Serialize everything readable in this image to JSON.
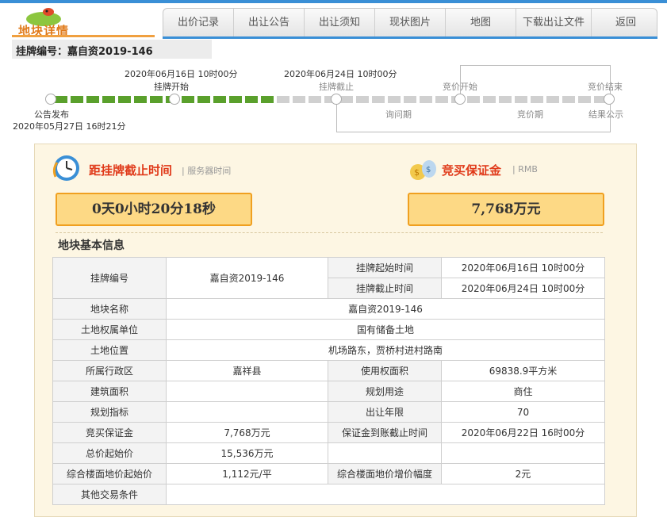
{
  "brand": {
    "title": "地块详情"
  },
  "nav": {
    "items": [
      "出价记录",
      "出让公告",
      "出让须知",
      "现状图片",
      "地图",
      "下载出让文件",
      "返回"
    ]
  },
  "page": {
    "listing_title": "挂牌编号：嘉自资2019-146"
  },
  "timeline": {
    "start_date": "2020年06月16日 10时00分",
    "start_label": "挂牌开始",
    "end_date": "2020年06月24日 10时00分",
    "end_label": "挂牌截止",
    "bid_start": "竞价开始",
    "bid_end": "竞价结束",
    "inquiry": "询问期",
    "bidding": "竞价期",
    "result": "结果公示",
    "publish_label": "公告发布",
    "publish_date": "2020年05月27日 16时21分",
    "colors": {
      "done": "#5aa02c",
      "pending": "#d0d0d0"
    }
  },
  "countdown": {
    "title": "距挂牌截止时间",
    "sub": "| 服务器时间",
    "value": "0天0小时20分18秒"
  },
  "deposit": {
    "title": "竞买保证金",
    "sub": "| RMB",
    "value": "7,768万元"
  },
  "basic_info": {
    "heading": "地块基本信息",
    "labels": {
      "listing_no": "挂牌编号",
      "start_time": "挂牌起始时间",
      "end_time": "挂牌截止时间",
      "parcel_name": "地块名称",
      "ownership": "土地权属单位",
      "location": "土地位置",
      "district": "所属行政区",
      "use_area": "使用权面积",
      "building_area": "建筑面积",
      "planned_use": "规划用途",
      "plan_index": "规划指标",
      "term": "出让年限",
      "deposit": "竞买保证金",
      "deposit_deadline": "保证金到账截止时间",
      "start_price": "总价起始价",
      "floor_price": "综合楼面地价起始价",
      "increment": "综合楼面地价增价幅度",
      "other": "其他交易条件"
    },
    "values": {
      "listing_no": "嘉自资2019-146",
      "start_time": "2020年06月16日 10时00分",
      "end_time": "2020年06月24日 10时00分",
      "parcel_name": "嘉自资2019-146",
      "ownership": "国有储备土地",
      "location": "机场路东，贾桥村进村路南",
      "district": "嘉祥县",
      "use_area": "69838.9平方米",
      "building_area": "",
      "planned_use": "商住",
      "plan_index": "",
      "term": "70",
      "deposit": "7,768万元",
      "deposit_deadline": "2020年06月22日 16时00分",
      "start_price": "15,536万元",
      "floor_price": "1,112元/平",
      "increment": "2元",
      "other": ""
    }
  }
}
